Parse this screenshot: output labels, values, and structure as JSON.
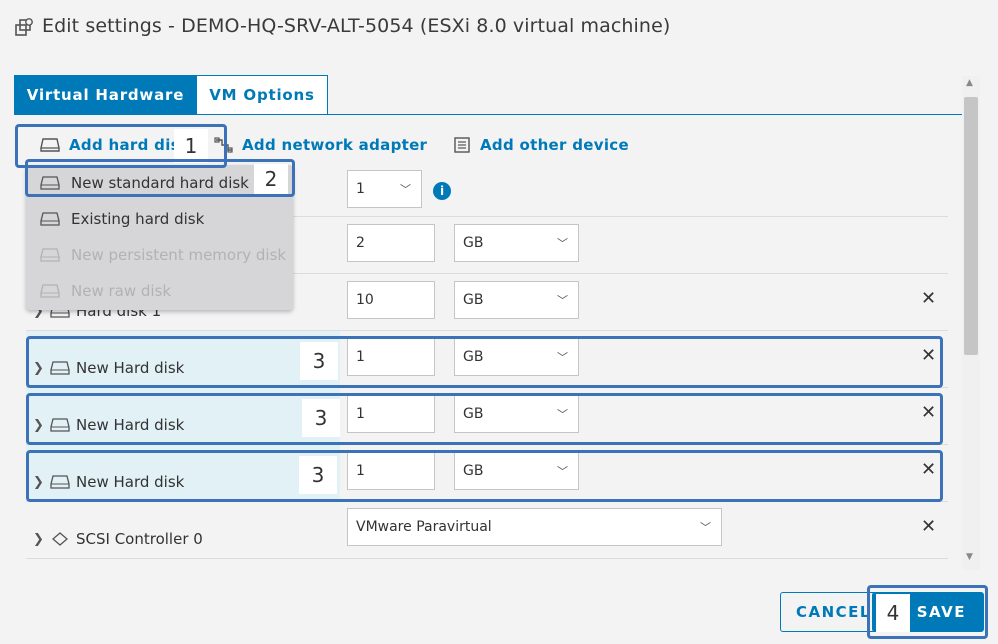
{
  "dialog": {
    "title": "Edit settings - DEMO-HQ-SRV-ALT-5054 (ESXi 8.0 virtual machine)"
  },
  "tabs": [
    {
      "label": "Virtual Hardware",
      "active": true
    },
    {
      "label": "VM Options",
      "active": false
    }
  ],
  "toolbar": {
    "add_hard_disk": "Add hard disk",
    "add_network_adapter": "Add network adapter",
    "add_other_device": "Add other device"
  },
  "menu": {
    "items": [
      {
        "label": "New standard hard disk",
        "enabled": true
      },
      {
        "label": "Existing hard disk",
        "enabled": true
      },
      {
        "label": "New persistent memory disk",
        "enabled": false
      },
      {
        "label": "New raw disk",
        "enabled": false
      }
    ]
  },
  "rows": {
    "cpu": {
      "value": "1"
    },
    "memory": {
      "value": "2",
      "unit": "GB"
    },
    "hard_disk_1": {
      "label": "Hard disk 1",
      "value": "10",
      "unit": "GB"
    },
    "new_disks": [
      {
        "label": "New Hard disk",
        "value": "1",
        "unit": "GB"
      },
      {
        "label": "New Hard disk",
        "value": "1",
        "unit": "GB"
      },
      {
        "label": "New Hard disk",
        "value": "1",
        "unit": "GB"
      }
    ],
    "scsi": {
      "label": "SCSI Controller 0",
      "value": "VMware Paravirtual"
    }
  },
  "callouts": {
    "step1": "1",
    "step2": "2",
    "step3": "3",
    "step4": "4"
  },
  "footer": {
    "cancel": "CANCEL",
    "save": "SAVE"
  },
  "colors": {
    "accent": "#0079b8",
    "callout": "#3c72b8",
    "highlight_row": "#e1f1f6"
  }
}
